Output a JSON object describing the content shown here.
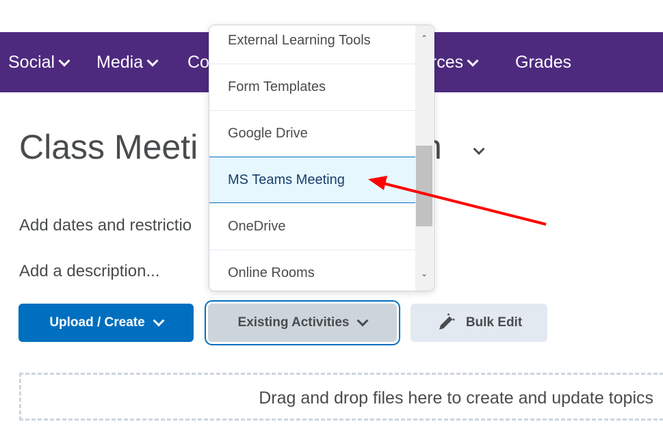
{
  "nav": {
    "items": [
      {
        "label": "Social",
        "dropdown": true
      },
      {
        "label": "Media",
        "dropdown": true
      },
      {
        "label": "Co",
        "dropdown": false
      },
      {
        "label": "urces",
        "dropdown": true
      },
      {
        "label": "Grades",
        "dropdown": false
      }
    ],
    "color": "#4e2a7e"
  },
  "page": {
    "title_start": "Class Meeti",
    "title_end": "n",
    "dates_link": "Add dates and restrictio",
    "description_placeholder": "Add a description..."
  },
  "buttons": {
    "upload": "Upload / Create",
    "existing": "Existing Activities",
    "bulk": "Bulk Edit"
  },
  "dropzone": {
    "text": "Drag and drop files here to create and update topics"
  },
  "menu": {
    "items": [
      "External Learning Tools",
      "Form Templates",
      "Google Drive",
      "MS Teams Meeting",
      "OneDrive",
      "Online Rooms"
    ],
    "selected": "MS Teams Meeting"
  },
  "annotation": {
    "arrow_color": "#ff0000"
  }
}
